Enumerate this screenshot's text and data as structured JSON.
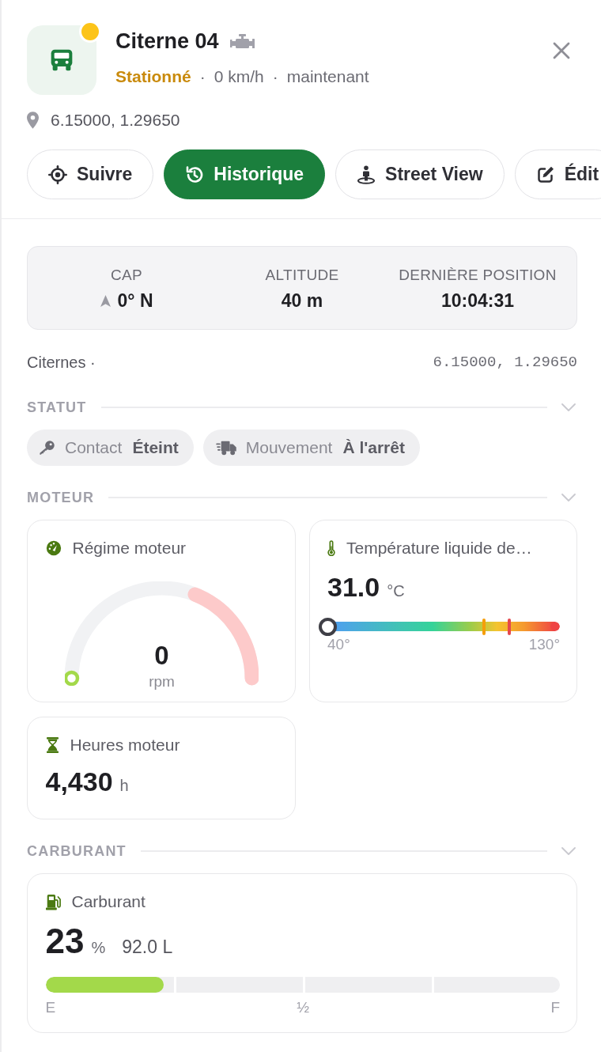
{
  "header": {
    "title": "Citerne 04",
    "meta": [
      {
        "kind": "status",
        "text": "Stationné"
      },
      {
        "kind": "separator",
        "text": "·"
      },
      {
        "kind": "text",
        "text": "0 km/h"
      },
      {
        "kind": "separator",
        "text": "·"
      },
      {
        "kind": "text",
        "text": "maintenant"
      }
    ],
    "location": "6.15000, 1.29650"
  },
  "actions": [
    {
      "label": "Suivre",
      "selected": false
    },
    {
      "label": "Historique",
      "selected": true
    },
    {
      "label": "Street View",
      "selected": false
    },
    {
      "label": "Édit",
      "selected": false
    }
  ],
  "summary": [
    {
      "kind": "heading",
      "label": "CAP",
      "value": "0° N"
    },
    {
      "kind": "plain",
      "label": "ALTITUDE",
      "value": "40 m"
    },
    {
      "kind": "plain",
      "label": "DERNIÈRE POSITION",
      "value": "10:04:31"
    }
  ],
  "group": {
    "name": "Citernes ·",
    "coordinates": "6.15000, 1.29650"
  },
  "sections": [
    {
      "title": "STATUT",
      "expanded": true,
      "chips": [
        {
          "label": "Contact",
          "value": "Éteint"
        },
        {
          "label": "Mouvement",
          "value": "À l'arrêt"
        }
      ]
    },
    {
      "title": "MOTEUR",
      "expanded": true,
      "cards": [
        {
          "kind": "gauge",
          "title": "Régime moteur",
          "value": "0",
          "unit": "rpm",
          "level": 0
        },
        {
          "kind": "range",
          "title": "Température liquide de…",
          "value": "31.0",
          "unit": "°C",
          "level": 0,
          "min_label": "40°",
          "max_label": "130°"
        },
        {
          "kind": "counter",
          "title": "Heures moteur",
          "value": "4,430",
          "unit": "h"
        }
      ]
    },
    {
      "title": "CARBURANT",
      "expanded": true,
      "cards": [
        {
          "kind": "fuel",
          "title": "Carburant",
          "value": "23",
          "unit": "%",
          "volume": "92.0 L",
          "level": 0.23,
          "scale": [
            "E",
            "½",
            "F"
          ]
        }
      ]
    }
  ]
}
